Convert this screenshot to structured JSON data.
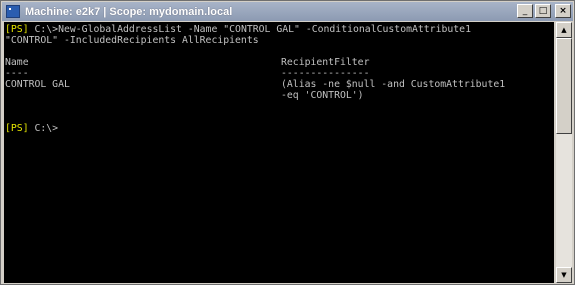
{
  "window": {
    "title": "Machine: e2k7 | Scope: mydomain.local",
    "minimize_symbol": "_",
    "maximize_symbol": "□",
    "close_symbol": "×"
  },
  "console": {
    "prompt": "[PS]",
    "command_path": " C:\\>",
    "command_line1": "New-GlobalAddressList -Name \"CONTROL GAL\" -ConditionalCustomAttribute1",
    "command_line2": "\"CONTROL\" -IncludedRecipients AllRecipients",
    "table": {
      "headers": [
        "Name",
        "RecipientFilter"
      ],
      "underlines": [
        "----",
        "---------------"
      ],
      "rows": [
        {
          "name": "CONTROL GAL",
          "filter_line1": "(Alias -ne $null -and CustomAttribute1",
          "filter_line2": "-eq 'CONTROL')"
        }
      ]
    },
    "final_prompt": "[PS]",
    "final_path": " C:\\>"
  },
  "scrollbar": {
    "up_symbol": "▲",
    "down_symbol": "▼"
  },
  "colors": {
    "console_bg": "#000000",
    "console_text": "#c0c0c0",
    "prompt_text": "#e8e800",
    "titlebar": "#8c9ab2"
  }
}
